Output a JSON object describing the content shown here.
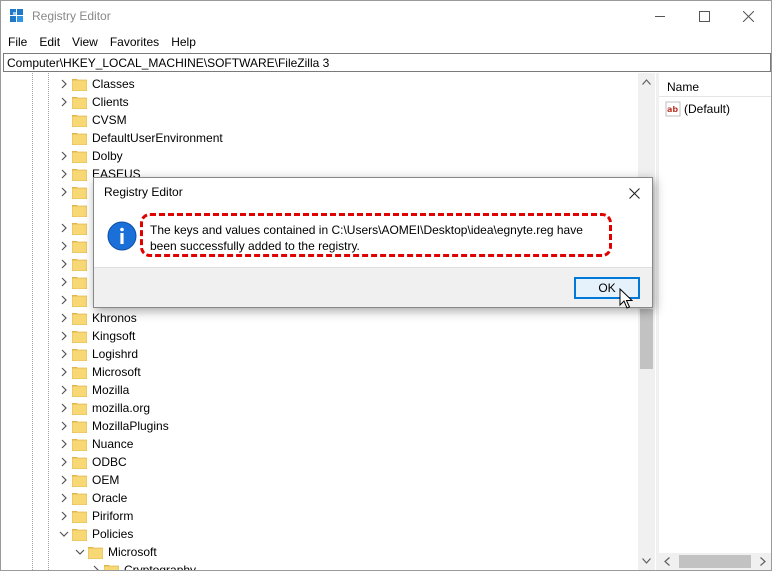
{
  "window": {
    "title": "Registry Editor",
    "controls": {
      "minimize": "–",
      "maximize": "□",
      "close": "✕"
    }
  },
  "menu": [
    "File",
    "Edit",
    "View",
    "Favorites",
    "Help"
  ],
  "address": "Computer\\HKEY_LOCAL_MACHINE\\SOFTWARE\\FileZilla 3",
  "tree": {
    "items": [
      {
        "label": "Classes",
        "expander": "collapsed"
      },
      {
        "label": "Clients",
        "expander": "collapsed"
      },
      {
        "label": "CVSM",
        "expander": "none"
      },
      {
        "label": "DefaultUserEnvironment",
        "expander": "none"
      },
      {
        "label": "Dolby",
        "expander": "collapsed"
      },
      {
        "label": "EASEUS",
        "expander": "collapsed"
      },
      {
        "label": "",
        "expander": "collapsed"
      },
      {
        "label": "",
        "expander": "none"
      },
      {
        "label": "",
        "expander": "collapsed"
      },
      {
        "label": "",
        "expander": "collapsed"
      },
      {
        "label": "",
        "expander": "collapsed"
      },
      {
        "label": "",
        "expander": "collapsed"
      },
      {
        "label": "",
        "expander": "collapsed"
      },
      {
        "label": "Khronos",
        "expander": "collapsed"
      },
      {
        "label": "Kingsoft",
        "expander": "collapsed"
      },
      {
        "label": "Logishrd",
        "expander": "collapsed"
      },
      {
        "label": "Microsoft",
        "expander": "collapsed"
      },
      {
        "label": "Mozilla",
        "expander": "collapsed"
      },
      {
        "label": "mozilla.org",
        "expander": "collapsed"
      },
      {
        "label": "MozillaPlugins",
        "expander": "collapsed"
      },
      {
        "label": "Nuance",
        "expander": "collapsed"
      },
      {
        "label": "ODBC",
        "expander": "collapsed"
      },
      {
        "label": "OEM",
        "expander": "collapsed"
      },
      {
        "label": "Oracle",
        "expander": "collapsed"
      },
      {
        "label": "Piriform",
        "expander": "collapsed"
      },
      {
        "label": "Policies",
        "expander": "expanded"
      },
      {
        "label": "Microsoft",
        "expander": "expanded",
        "child": true
      },
      {
        "label": "Cryptography",
        "expander": "collapsed",
        "child2": true
      }
    ]
  },
  "list": {
    "column_name": "Name",
    "values": [
      {
        "name": "(Default)",
        "icon": "string-value-icon"
      }
    ]
  },
  "dialog": {
    "title": "Registry Editor",
    "message": "The keys and values contained in C:\\Users\\AOMEI\\Desktop\\idea\\egnyte.reg have been successfully added to the registry.",
    "ok_label": "OK",
    "highlight_color": "#e00000"
  },
  "colors": {
    "folder": "#f8d775",
    "info_blue": "#1a6fd8",
    "accent": "#0078d7"
  }
}
